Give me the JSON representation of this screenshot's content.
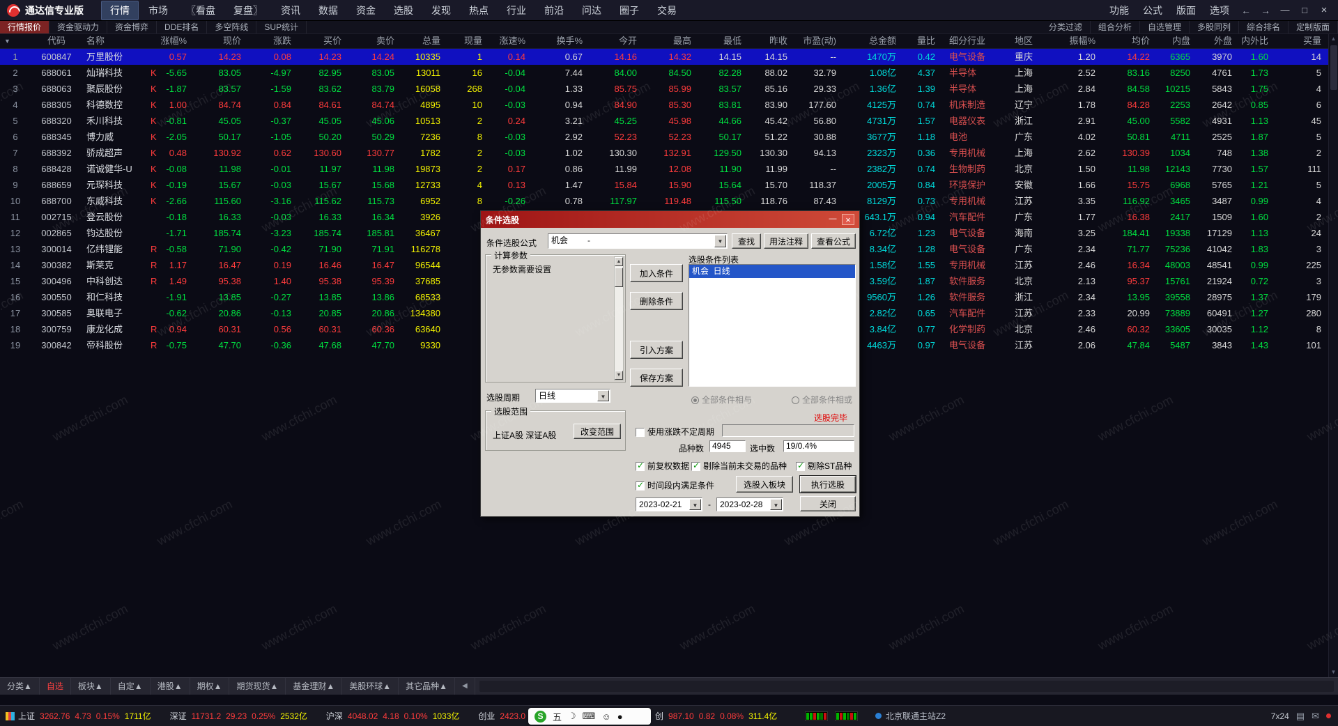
{
  "palette": {
    "up": "#ff3c3c",
    "down": "#00e040",
    "white": "#d9d9d9",
    "yellow": "#f2f200",
    "cyan": "#00dcdc",
    "industry": "#d94f4f",
    "gray": "#8d95a3",
    "selected_row_bg": "#1010c0"
  },
  "window": {
    "title": "通达信专业版",
    "menus": [
      "行情",
      "市场",
      "〖看盘",
      "复盘〗",
      "资讯",
      "数据",
      "资金",
      "选股",
      "发现",
      "热点",
      "行业",
      "前沿",
      "问达",
      "圈子",
      "交易"
    ],
    "active_menu": "行情",
    "right_menus": [
      "功能",
      "公式",
      "版面",
      "选项"
    ],
    "nav_back": "←",
    "nav_forward": "→",
    "minimize": "—",
    "maximize": "□",
    "close": "×"
  },
  "toolbar": {
    "items": [
      "行情报价",
      "资金驱动力",
      "资金博弈",
      "DDE排名",
      "多空阵线",
      "SUP统计"
    ],
    "active_item": "行情报价",
    "right_items": [
      "分类过滤",
      "组合分析",
      "自选管理",
      "多股同列",
      "综合排名",
      "定制版面"
    ]
  },
  "table": {
    "sort_indicator": "▼",
    "columns": [
      "代码",
      "名称",
      "",
      "涨幅%",
      "现价",
      "涨跌",
      "买价",
      "卖价",
      "总量",
      "现量",
      "涨速%",
      "换手%",
      "今开",
      "最高",
      "最低",
      "昨收",
      "市盈(动)",
      "总金额",
      "量比",
      "细分行业",
      "地区",
      "振幅%",
      "均价",
      "内盘",
      "外盘",
      "内外比",
      "买量"
    ],
    "selected_row": 1,
    "rows": [
      [
        "600847",
        "万里股份",
        "",
        "0.57",
        "14.23",
        "0.08",
        "14.23",
        "14.24",
        "10335",
        "1",
        "0.14",
        "0.67",
        "14.16",
        "14.32",
        "14.15",
        "14.15",
        "--",
        "1470万",
        "0.42",
        "电气设备",
        "重庆",
        "1.20",
        "14.22",
        "6365",
        "3970",
        "1.60",
        "14"
      ],
      [
        "688061",
        "灿瑞科技",
        "K",
        "-5.65",
        "83.05",
        "-4.97",
        "82.95",
        "83.05",
        "13011",
        "16",
        "-0.04",
        "7.44",
        "84.00",
        "84.50",
        "82.28",
        "88.02",
        "32.79",
        "1.08亿",
        "4.37",
        "半导体",
        "上海",
        "2.52",
        "83.16",
        "8250",
        "4761",
        "1.73",
        "5"
      ],
      [
        "688063",
        "聚辰股份",
        "K",
        "-1.87",
        "83.57",
        "-1.59",
        "83.62",
        "83.79",
        "16058",
        "268",
        "-0.04",
        "1.33",
        "85.75",
        "85.99",
        "83.57",
        "85.16",
        "29.33",
        "1.36亿",
        "1.39",
        "半导体",
        "上海",
        "2.84",
        "84.58",
        "10215",
        "5843",
        "1.75",
        "4"
      ],
      [
        "688305",
        "科德数控",
        "K",
        "1.00",
        "84.74",
        "0.84",
        "84.61",
        "84.74",
        "4895",
        "10",
        "-0.03",
        "0.94",
        "84.90",
        "85.30",
        "83.81",
        "83.90",
        "177.60",
        "4125万",
        "0.74",
        "机床制造",
        "辽宁",
        "1.78",
        "84.28",
        "2253",
        "2642",
        "0.85",
        "6"
      ],
      [
        "688320",
        "禾川科技",
        "K",
        "-0.81",
        "45.05",
        "-0.37",
        "45.05",
        "45.06",
        "10513",
        "2",
        "0.24",
        "3.21",
        "45.25",
        "45.98",
        "44.66",
        "45.42",
        "56.80",
        "4731万",
        "1.57",
        "电器仪表",
        "浙江",
        "2.91",
        "45.00",
        "5582",
        "4931",
        "1.13",
        "45"
      ],
      [
        "688345",
        "博力威",
        "K",
        "-2.05",
        "50.17",
        "-1.05",
        "50.20",
        "50.29",
        "7236",
        "8",
        "-0.03",
        "2.92",
        "52.23",
        "52.23",
        "50.17",
        "51.22",
        "30.88",
        "3677万",
        "1.18",
        "电池",
        "广东",
        "4.02",
        "50.81",
        "4711",
        "2525",
        "1.87",
        "5"
      ],
      [
        "688392",
        "骄成超声",
        "K",
        "0.48",
        "130.92",
        "0.62",
        "130.60",
        "130.77",
        "1782",
        "2",
        "-0.03",
        "1.02",
        "130.30",
        "132.91",
        "129.50",
        "130.30",
        "94.13",
        "2323万",
        "0.36",
        "专用机械",
        "上海",
        "2.62",
        "130.39",
        "1034",
        "748",
        "1.38",
        "2"
      ],
      [
        "688428",
        "诺诚健华-U",
        "K",
        "-0.08",
        "11.98",
        "-0.01",
        "11.97",
        "11.98",
        "19873",
        "2",
        "0.17",
        "0.86",
        "11.99",
        "12.08",
        "11.90",
        "11.99",
        "--",
        "2382万",
        "0.74",
        "生物制药",
        "北京",
        "1.50",
        "11.98",
        "12143",
        "7730",
        "1.57",
        "111"
      ],
      [
        "688659",
        "元琛科技",
        "K",
        "-0.19",
        "15.67",
        "-0.03",
        "15.67",
        "15.68",
        "12733",
        "4",
        "0.13",
        "1.47",
        "15.84",
        "15.90",
        "15.64",
        "15.70",
        "118.37",
        "2005万",
        "0.84",
        "环境保护",
        "安徽",
        "1.66",
        "15.75",
        "6968",
        "5765",
        "1.21",
        "5"
      ],
      [
        "688700",
        "东威科技",
        "K",
        "-2.66",
        "115.60",
        "-3.16",
        "115.62",
        "115.73",
        "6952",
        "8",
        "-0.26",
        "0.78",
        "117.97",
        "119.48",
        "115.50",
        "118.76",
        "87.43",
        "8129万",
        "0.73",
        "专用机械",
        "江苏",
        "3.35",
        "116.92",
        "3465",
        "3487",
        "0.99",
        "4"
      ],
      [
        "002715",
        "登云股份",
        "",
        "-0.18",
        "16.33",
        "-0.03",
        "16.33",
        "16.34",
        "3926",
        "",
        "",
        "",
        "",
        "",
        "",
        "",
        "",
        "643.1万",
        "0.94",
        "汽车配件",
        "广东",
        "1.77",
        "16.38",
        "2417",
        "1509",
        "1.60",
        "2"
      ],
      [
        "002865",
        "钧达股份",
        "",
        "-1.71",
        "185.74",
        "-3.23",
        "185.74",
        "185.81",
        "36467",
        "",
        "",
        "",
        "",
        "",
        "",
        "",
        "",
        "6.72亿",
        "1.23",
        "电气设备",
        "海南",
        "3.25",
        "184.41",
        "19338",
        "17129",
        "1.13",
        "24"
      ],
      [
        "300014",
        "亿纬锂能",
        "R",
        "-0.58",
        "71.90",
        "-0.42",
        "71.90",
        "71.91",
        "116278",
        "",
        "",
        "",
        "",
        "",
        "",
        "",
        "",
        "8.34亿",
        "1.28",
        "电气设备",
        "广东",
        "2.34",
        "71.77",
        "75236",
        "41042",
        "1.83",
        "3"
      ],
      [
        "300382",
        "斯莱克",
        "R",
        "1.17",
        "16.47",
        "0.19",
        "16.46",
        "16.47",
        "96544",
        "",
        "",
        "",
        "",
        "",
        "",
        "",
        "",
        "1.58亿",
        "1.55",
        "专用机械",
        "江苏",
        "2.46",
        "16.34",
        "48003",
        "48541",
        "0.99",
        "225"
      ],
      [
        "300496",
        "中科创达",
        "R",
        "1.49",
        "95.38",
        "1.40",
        "95.38",
        "95.39",
        "37685",
        "",
        "",
        "",
        "",
        "",
        "",
        "",
        "",
        "3.59亿",
        "1.87",
        "软件服务",
        "北京",
        "2.13",
        "95.37",
        "15761",
        "21924",
        "0.72",
        "3"
      ],
      [
        "300550",
        "和仁科技",
        "",
        "-1.91",
        "13.85",
        "-0.27",
        "13.85",
        "13.86",
        "68533",
        "",
        "",
        "",
        "",
        "",
        "",
        "",
        "",
        "9560万",
        "1.26",
        "软件服务",
        "浙江",
        "2.34",
        "13.95",
        "39558",
        "28975",
        "1.37",
        "179"
      ],
      [
        "300585",
        "奥联电子",
        "",
        "-0.62",
        "20.86",
        "-0.13",
        "20.85",
        "20.86",
        "134380",
        "",
        "",
        "",
        "",
        "",
        "",
        "",
        "",
        "2.82亿",
        "0.65",
        "汽车配件",
        "江苏",
        "2.33",
        "20.99",
        "73889",
        "60491",
        "1.27",
        "280"
      ],
      [
        "300759",
        "康龙化成",
        "R",
        "0.94",
        "60.31",
        "0.56",
        "60.31",
        "60.36",
        "63640",
        "",
        "",
        "",
        "",
        "",
        "",
        "",
        "",
        "3.84亿",
        "0.77",
        "化学制药",
        "北京",
        "2.46",
        "60.32",
        "33605",
        "30035",
        "1.12",
        "8"
      ],
      [
        "300842",
        "帝科股份",
        "R",
        "-0.75",
        "47.70",
        "-0.36",
        "47.68",
        "47.70",
        "9330",
        "",
        "",
        "",
        "",
        "",
        "",
        "",
        "",
        "4463万",
        "0.97",
        "电气设备",
        "江苏",
        "2.06",
        "47.84",
        "5487",
        "3843",
        "1.43",
        "101"
      ]
    ]
  },
  "dialog": {
    "title": "条件选股",
    "minimize": "—",
    "close": "×",
    "formula_label": "条件选股公式",
    "formula_value": "机会",
    "formula_desc": "-",
    "find_button": "查找",
    "usage_button": "用法注释",
    "view_button": "查看公式",
    "params_group": "计算参数",
    "params_empty_text": "无参数需要设置",
    "period_label": "选股周期",
    "period_value": "日线",
    "range_group": "选股范围",
    "range_text": "上证A股 深证A股",
    "range_button": "改变范围",
    "add_button": "加入条件",
    "delete_button": "删除条件",
    "import_button": "引入方案",
    "save_button": "保存方案",
    "list_label": "选股条件列表",
    "list_item": "机会  日线",
    "radio_and": "全部条件相与",
    "radio_or": "全部条件相或",
    "done_text": "选股完毕",
    "cb_irregular": "使用涨跌不定周期",
    "count_label": "品种数",
    "count_value": "4945",
    "hit_label": "选中数",
    "hit_value": "19/0.4%",
    "cb_fuquan": "前复权数据",
    "cb_no_untraded": "剔除当前未交易的品种",
    "cb_no_st": "剔除ST品种",
    "cb_timerange": "时间段内满足条件",
    "to_block_button": "选股入板块",
    "run_button": "执行选股",
    "date_from": "2023-02-21",
    "date_sep": "-",
    "date_to": "2023-02-28",
    "close_button": "关闭"
  },
  "bottom_tabs": {
    "items": [
      "分类▲",
      "自选",
      "板块▲",
      "自定▲",
      "港股▲",
      "期权▲",
      "期货现货▲",
      "基金理财▲",
      "美股环球▲",
      "其它品种▲"
    ],
    "active": "自选",
    "scroll_left": "◀"
  },
  "statusbar": {
    "indices": [
      {
        "label": "上证",
        "value": "3262.76",
        "change": "4.73",
        "pct": "0.15%",
        "amount": "1711亿"
      },
      {
        "label": "深证",
        "value": "11731.2",
        "change": "29.23",
        "pct": "0.25%",
        "amount": "2532亿"
      },
      {
        "label": "沪深",
        "value": "4048.02",
        "change": "4.18",
        "pct": "0.10%",
        "amount": "1033亿"
      },
      {
        "label": "创业",
        "value": "2423.0",
        "change": "",
        "pct": "",
        "amount": ""
      }
    ],
    "index2": {
      "label": "创",
      "value": "987.10",
      "change": "0.82",
      "pct": "0.08%",
      "amount": "311.4亿"
    },
    "heat_bars": [
      [
        "#00b400",
        "#00b400",
        "#cc1111",
        "#00b400",
        "#007700",
        "#cc1111"
      ],
      [
        "#00b400",
        "#cc1111",
        "#00b400",
        "#007700",
        "#cc1111",
        "#00b400"
      ]
    ],
    "server": "北京联通主站Z2",
    "uptime": "7x24",
    "ime": {
      "logo": "S",
      "item1": "五",
      "item2": "☽",
      "item3": "⌨",
      "item4": "☺",
      "item5": "●"
    }
  },
  "watermark": "www.cfchi.com"
}
